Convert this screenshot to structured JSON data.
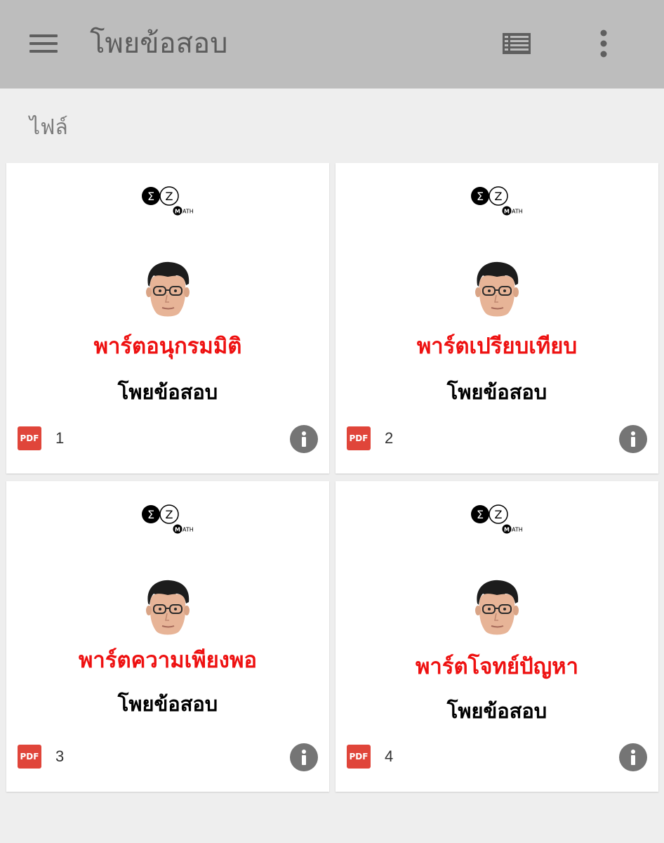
{
  "app_bar": {
    "title": "โพยข้อสอบ",
    "menu_icon": "hamburger-menu-icon",
    "view_icon": "list-view-icon",
    "more_icon": "more-vert-icon",
    "background_color": "#bdbdbd"
  },
  "section": {
    "label": "ไฟล์"
  },
  "files": [
    {
      "preview_title": "พาร์ตอนุกรมมิติ",
      "preview_subtitle": "โพยข้อสอบ",
      "type_badge": "PDF",
      "name": "1"
    },
    {
      "preview_title": "พาร์ตเปรียบเทียบ",
      "preview_subtitle": "โพยข้อสอบ",
      "type_badge": "PDF",
      "name": "2"
    },
    {
      "preview_title": "พาร์ตความเพียงพอ",
      "preview_subtitle": "โพยข้อสอบ",
      "type_badge": "PDF",
      "name": "3"
    },
    {
      "preview_title": "พาร์ตโจทย์ปัญหา",
      "preview_subtitle": "โพยข้อสอบ",
      "type_badge": "PDF",
      "name": "4"
    }
  ],
  "logo": {
    "sigma": "Σ",
    "letter": "Z",
    "m": "M",
    "rest": "ATH"
  },
  "colors": {
    "title_red": "#ee1111",
    "pdf_red": "#e0453a",
    "info_gray": "#757575"
  }
}
